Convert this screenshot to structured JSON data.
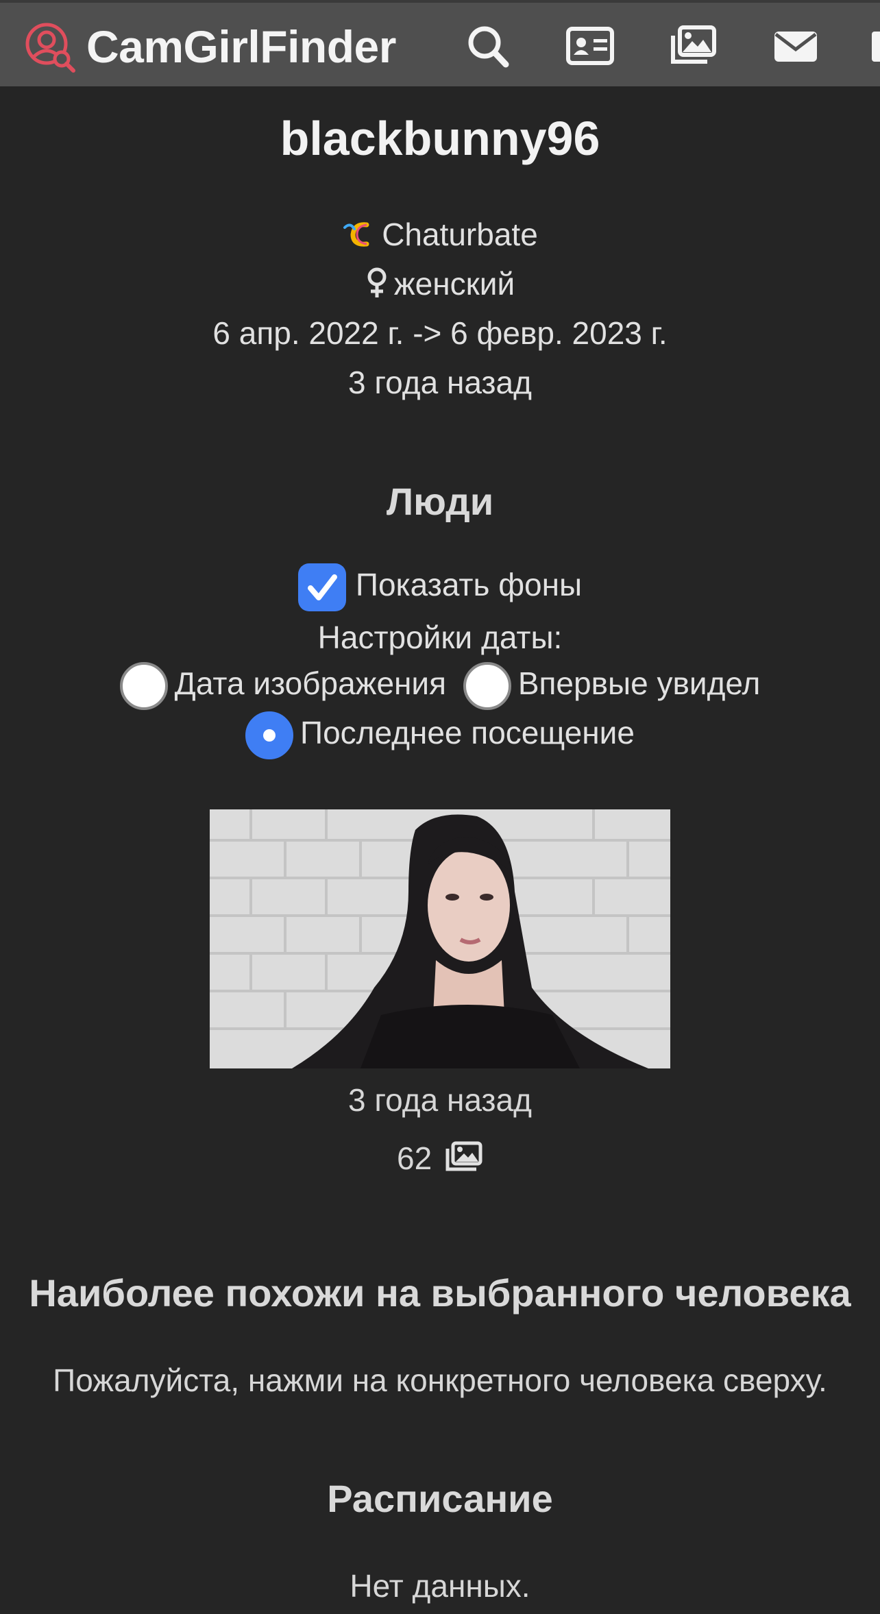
{
  "navbar": {
    "brand": "CamGirlFinder",
    "icons": [
      "search-icon",
      "id-card-icon",
      "images-icon",
      "envelope-icon",
      "partial-icon"
    ],
    "accent_color": "#e04e5d"
  },
  "profile": {
    "username": "blackbunny96",
    "platform": "Chaturbate",
    "gender": "женский",
    "date_range": "6 апр. 2022 г. -> 6 февр. 2023 г.",
    "relative_time": "3 года назад"
  },
  "people": {
    "heading": "Люди",
    "show_backgrounds_label": "Показать фоны",
    "show_backgrounds_checked": true,
    "date_settings_label": "Настройки даты:",
    "date_options": [
      {
        "label": "Дата изображения",
        "checked": false
      },
      {
        "label": "Впервые увидел",
        "checked": false
      },
      {
        "label": "Последнее посещение",
        "checked": true
      }
    ]
  },
  "photo_card": {
    "relative_time": "3 года назад",
    "image_count": "62"
  },
  "similar": {
    "heading": "Наиболее похожи на выбранного человека",
    "text": "Пожалуйста, нажми на конкретного человека сверху."
  },
  "schedule": {
    "heading": "Расписание",
    "text": "Нет данных."
  },
  "colors": {
    "background": "#252525",
    "navbar": "#4f4f4f",
    "control_blue": "#3f7ef4"
  }
}
